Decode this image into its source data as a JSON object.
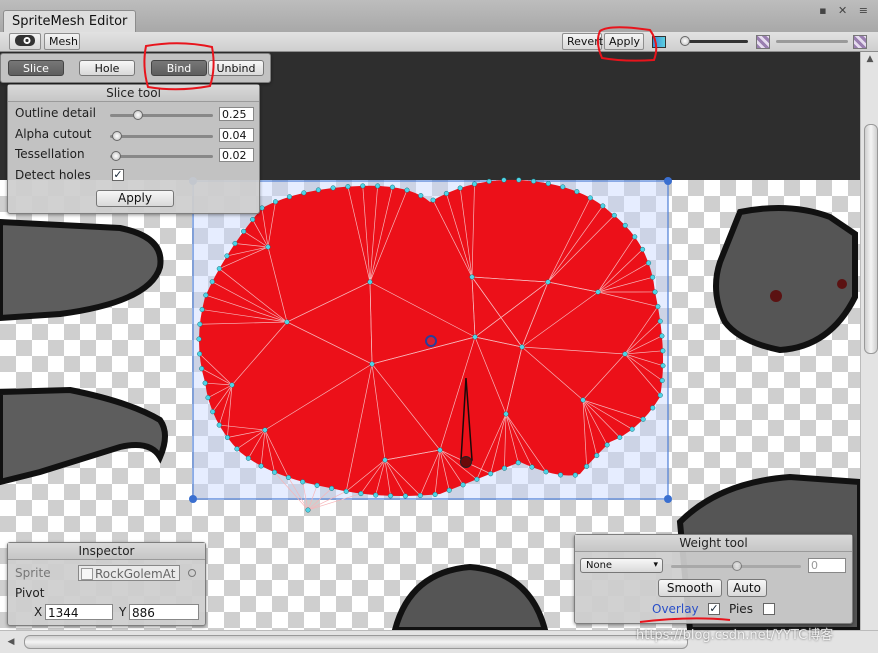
{
  "window": {
    "tab_title": "SpriteMesh Editor",
    "controls_glyph": "▪ ✕ ≡"
  },
  "toolbar": {
    "overlay_icon": "eye-overlay-icon",
    "mesh_label": "Mesh",
    "revert_label": "Revert",
    "apply_label": "Apply"
  },
  "modes": {
    "slice": "Slice",
    "hole": "Hole",
    "bind": "Bind",
    "unbind": "Unbind"
  },
  "slice_tool": {
    "title": "Slice tool",
    "outline_label": "Outline detail",
    "outline_value": "0.25",
    "alpha_label": "Alpha cutout",
    "alpha_value": "0.04",
    "tess_label": "Tessellation",
    "tess_value": "0.02",
    "holes_label": "Detect holes",
    "holes_checked": "✓",
    "apply_label": "Apply"
  },
  "inspector": {
    "title": "Inspector",
    "sprite_label": "Sprite",
    "sprite_value": "RockGolemAt",
    "pivot_label": "Pivot",
    "x_label": "X",
    "x_value": "1344",
    "y_label": "Y",
    "y_value": "886"
  },
  "weight_tool": {
    "title": "Weight tool",
    "bone_select": "None",
    "weight_value": "0",
    "smooth_label": "Smooth",
    "auto_label": "Auto",
    "overlay_label": "Overlay",
    "overlay_checked": "✓",
    "pies_label": "Pies"
  },
  "watermark": "https://blog.csdn.net/YYTC博客",
  "colors": {
    "mesh_fill": "#ec1019",
    "vertex": "#4fd4e6",
    "selection": "#4d7fd6",
    "annotation": "#e8141c"
  }
}
